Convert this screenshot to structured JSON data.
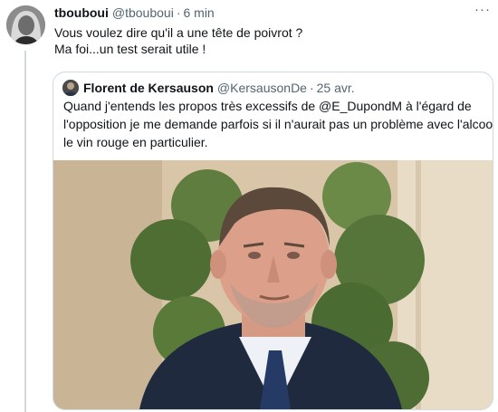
{
  "tweet": {
    "author_name": "tbouboui",
    "author_handle": "@tbouboui",
    "separator": "·",
    "time": "6 min",
    "more_label": "···",
    "text_lines": [
      "Vous voulez dire qu'il a une tête de poivrot ?",
      "Ma foi...un test serait utile !"
    ]
  },
  "quoted_tweet": {
    "author_name": "Florent de Kersauson",
    "author_handle": "@KersausonDe",
    "separator": "·",
    "time": "25 avr.",
    "text_lines": [
      "Quand j'entends les propos très excessifs de @E_DupondM à l'égard de",
      "l'opposition je me demande parfois si il n'aurait pas un problème avec l'alcool,",
      "le vin rouge en particulier."
    ],
    "media": {
      "kind": "photo",
      "subject": "portrait"
    }
  },
  "colors": {
    "text_primary": "#0f1419",
    "text_secondary": "#536471",
    "border": "#cfd9de"
  }
}
